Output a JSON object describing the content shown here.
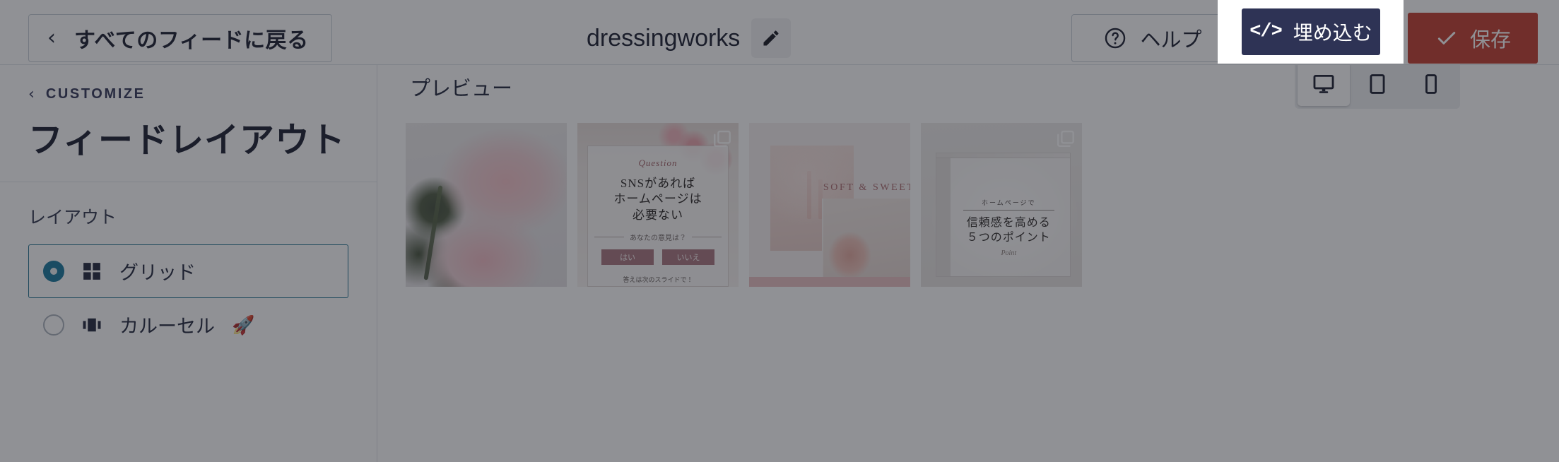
{
  "topbar": {
    "back_button": {
      "label": "すべてのフィードに戻る",
      "icon": "chevron-left-icon"
    },
    "feed_title": "dressingworks",
    "edit_icon": "pencil-icon",
    "help_button": {
      "label": "ヘルプ",
      "icon": "question-circle-icon"
    },
    "embed_button": {
      "label": "埋め込む",
      "icon": "code-brackets-icon",
      "background": "#2e3355",
      "highlighted": true
    },
    "save_button": {
      "label": "保存",
      "icon": "check-icon",
      "background": "#c0392b"
    }
  },
  "sidebar": {
    "breadcrumb": {
      "label": "CUSTOMIZE",
      "icon": "chevron-left-icon"
    },
    "page_title": "フィードレイアウト",
    "section_label": "レイアウト",
    "accent_color": "#13749a",
    "options": [
      {
        "label": "グリッド",
        "icon": "grid-icon",
        "selected": true,
        "badge": ""
      },
      {
        "label": "カルーセル",
        "icon": "carousel-icon",
        "selected": false,
        "badge": "🚀"
      }
    ]
  },
  "preview": {
    "label": "プレビュー",
    "devices": [
      {
        "name": "desktop",
        "icon": "desktop-icon",
        "active": true
      },
      {
        "name": "tablet",
        "icon": "tablet-icon",
        "active": false
      },
      {
        "name": "mobile",
        "icon": "mobile-icon",
        "active": false
      }
    ],
    "tiles": [
      {
        "name": "rose-photo",
        "kind": "photo",
        "carousel": false
      },
      {
        "name": "question-card",
        "kind": "graphic",
        "carousel": true,
        "script": "Question",
        "heading_line1": "SNSがあれば",
        "heading_line2": "ホームページは",
        "heading_line3": "必要ない",
        "subtitle": "あなたの意見は？",
        "button_yes": "はい",
        "button_no": "いいえ",
        "footer": "答えは次のスライドで！"
      },
      {
        "name": "soft-and-sweet",
        "kind": "collage",
        "carousel": false,
        "title": "SOFT & SWEET"
      },
      {
        "name": "trust-points",
        "kind": "graphic",
        "carousel": true,
        "eyebrow": "ホームページで",
        "line1": "信頼感を高める",
        "line2": "５つのポイント",
        "script": "Point"
      }
    ]
  }
}
